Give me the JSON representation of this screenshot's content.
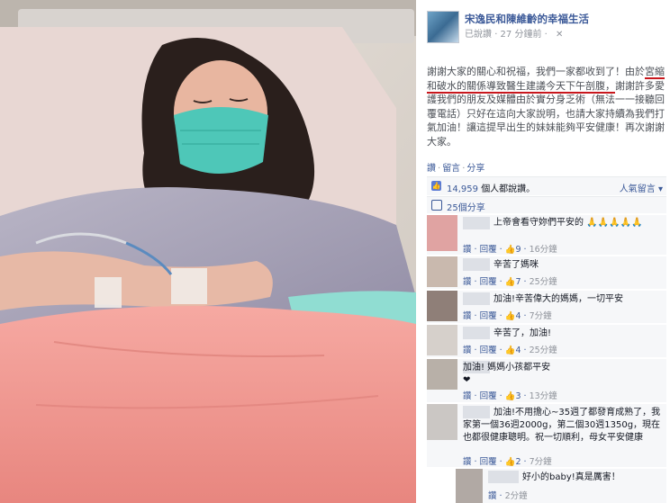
{
  "post": {
    "page_name": "宋逸民和陳維齡的幸福生活",
    "meta_liked": "已說讚",
    "meta_time": "27 分鐘前",
    "meta_close": "✕",
    "body_part1": "謝謝大家的關心和祝福，我們一家都收到了！由於",
    "body_part2": "宮縮和破水的關係導致醫生建議今天下午剖腹，",
    "body_part3": "謝謝許多愛護我們的朋友及媒體由於實分身乏術（無法一一接聽回覆電話）只好在這向大家說明，也請大家持續為我們打氣加油！讓這提早出生的妹妹能夠平安健康！再次謝謝大家。"
  },
  "actions": {
    "like": "讚",
    "comment": "留言",
    "share": "分享"
  },
  "likes": {
    "count": "14,959",
    "suffix": "個人都說讚。",
    "sort": "人氣留言 ▾"
  },
  "shares": {
    "text": "25個分享"
  },
  "comments": [
    {
      "text": "上帝會看守妳們平安的 🙏🙏🙏🙏🙏",
      "time": "16分鐘",
      "likes": "9"
    },
    {
      "text": "辛苦了媽咪",
      "time": "25分鐘",
      "likes": "7"
    },
    {
      "text": "加油!辛苦偉大的媽媽，一切平安",
      "time": "7分鐘",
      "likes": "4"
    },
    {
      "text": "辛苦了，加油!",
      "time": "25分鐘",
      "likes": "4"
    },
    {
      "text": "加油! 媽媽小孩都平安 ❤",
      "time": "13分鐘",
      "likes": "3"
    },
    {
      "text": "加油!不用擔心~35週了都發育成熟了，我家第一個36週2000g，第二個30週1350g，現在也都很健康聰明。祝一切順利，母女平安健康",
      "time": "7分鐘",
      "likes": "2"
    },
    {
      "text": "好小的baby!真是厲害！",
      "time": "2分鐘",
      "likes": ""
    }
  ],
  "comment_actions": {
    "like": "讚",
    "reply": "回覆"
  },
  "colors": {
    "link": "#3b5998",
    "underline": "#c8171d",
    "panel_bg": "#f6f7f9"
  }
}
